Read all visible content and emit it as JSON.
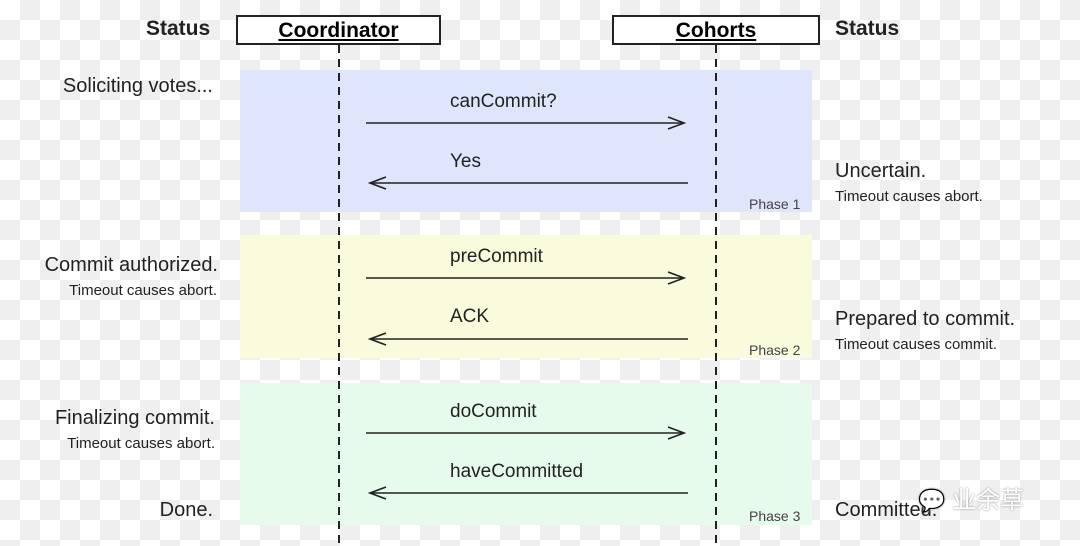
{
  "header": {
    "left_status": "Status",
    "right_status": "Status",
    "coordinator": "Coordinator",
    "cohorts": "Cohorts"
  },
  "phases": [
    {
      "label": "Phase 1",
      "color": "#dfe6fb",
      "messages": [
        {
          "text": "canCommit?",
          "direction": "right"
        },
        {
          "text": "Yes",
          "direction": "left"
        }
      ],
      "coordinator_status": "Soliciting votes...",
      "coordinator_note": "",
      "cohort_status": "Uncertain.",
      "cohort_note": "Timeout causes abort."
    },
    {
      "label": "Phase 2",
      "color": "#fafadd",
      "messages": [
        {
          "text": "preCommit",
          "direction": "right"
        },
        {
          "text": "ACK",
          "direction": "left"
        }
      ],
      "coordinator_status": "Commit authorized.",
      "coordinator_note": "Timeout causes abort.",
      "cohort_status": "Prepared to commit.",
      "cohort_note": "Timeout causes commit."
    },
    {
      "label": "Phase 3",
      "color": "#e6fbec",
      "messages": [
        {
          "text": "doCommit",
          "direction": "right"
        },
        {
          "text": "haveCommitted",
          "direction": "left"
        }
      ],
      "coordinator_status": "Finalizing commit.",
      "coordinator_note": "Timeout causes abort.",
      "coordinator_final": "Done.",
      "cohort_status": "Committed."
    }
  ],
  "watermark": "业余草"
}
